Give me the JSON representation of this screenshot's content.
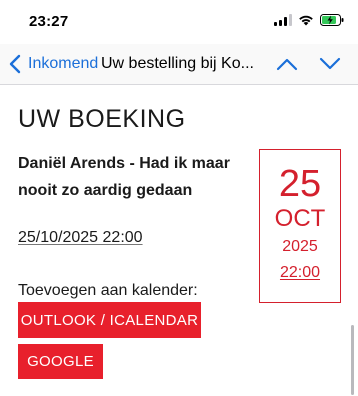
{
  "status_bar": {
    "time": "23:27"
  },
  "nav": {
    "back_label": "Inkomend",
    "title": "Uw bestelling bij Ko..."
  },
  "content": {
    "heading": "UW BOEKING",
    "event_title": "Daniël Arends - Had ik maar nooit zo aardig gedaan",
    "event_datetime": "25/10/2025 22:00",
    "date_box": {
      "day": "25",
      "month": "OCT",
      "year": "2025",
      "time": "22:00"
    },
    "calendar_label": "Toevoegen aan kalender:",
    "buttons": {
      "outlook": "OUTLOOK / ICALENDAR",
      "google": "GOOGLE"
    }
  },
  "colors": {
    "accent_red": "#e8202c",
    "link_blue": "#1b6fd9",
    "battery_green": "#34c759"
  },
  "icons": [
    "signal-icon",
    "wifi-icon",
    "battery-charging-icon",
    "chevron-left-icon",
    "chevron-up-icon",
    "chevron-down-icon"
  ]
}
